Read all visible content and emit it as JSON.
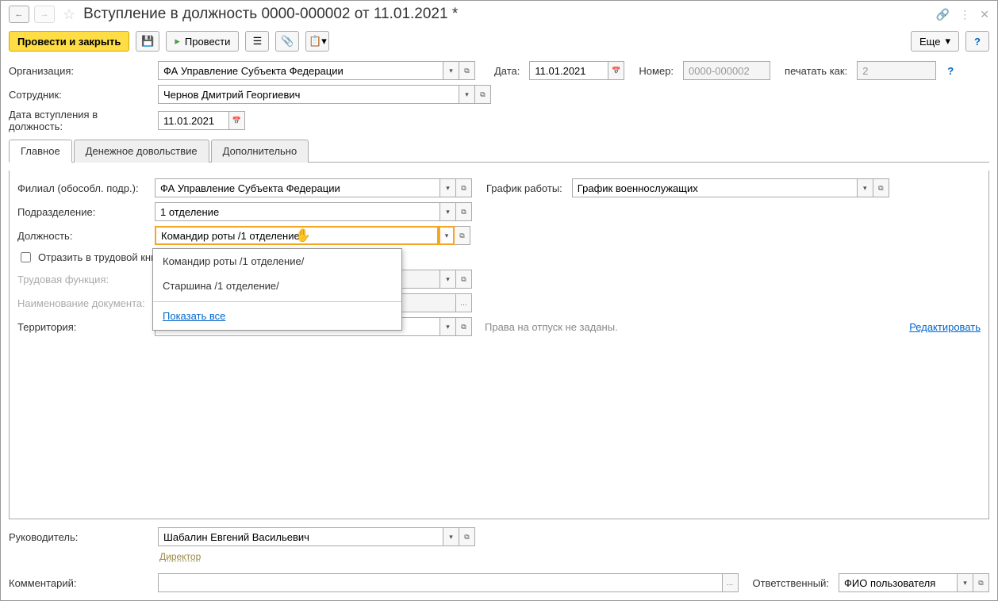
{
  "title": "Вступление в должность 0000-000002 от 11.01.2021 *",
  "toolbar": {
    "post_close": "Провести и закрыть",
    "post": "Провести",
    "more": "Еще"
  },
  "header": {
    "org_label": "Организация:",
    "org_value": "ФА Управление Субъекта Федерации",
    "date_label": "Дата:",
    "date_value": "11.01.2021",
    "number_label": "Номер:",
    "number_value": "0000-000002",
    "print_as_label": "печатать как:",
    "print_as_value": "2",
    "employee_label": "Сотрудник:",
    "employee_value": "Чернов Дмитрий Георгиевич",
    "entry_date_label": "Дата вступления в должность:",
    "entry_date_value": "11.01.2021"
  },
  "tabs": {
    "main": "Главное",
    "money": "Денежное довольствие",
    "extra": "Дополнительно"
  },
  "main_tab": {
    "branch_label": "Филиал (обособл. подр.):",
    "branch_value": "ФА Управление Субъекта Федерации",
    "schedule_label": "График работы:",
    "schedule_value": "График военнослужащих",
    "dept_label": "Подразделение:",
    "dept_value": "1 отделение",
    "position_label": "Должность:",
    "position_value": "Командир роты /1 отделение",
    "reflect_label": "Отразить в трудовой книжке",
    "labor_fn_label": "Трудовая функция:",
    "doc_name_label": "Наименование документа:",
    "territory_label": "Территория:",
    "vacation_text": "Права на отпуск не заданы.",
    "edit_link": "Редактировать"
  },
  "dropdown": {
    "items": [
      "Командир роты /1 отделение/",
      "Старшина /1 отделение/"
    ],
    "show_all": "Показать все"
  },
  "footer": {
    "manager_label": "Руководитель:",
    "manager_value": "Шабалин Евгений Васильевич",
    "manager_role": "Директор",
    "comment_label": "Комментарий:",
    "responsible_label": "Ответственный:",
    "responsible_value": "ФИО пользователя"
  }
}
